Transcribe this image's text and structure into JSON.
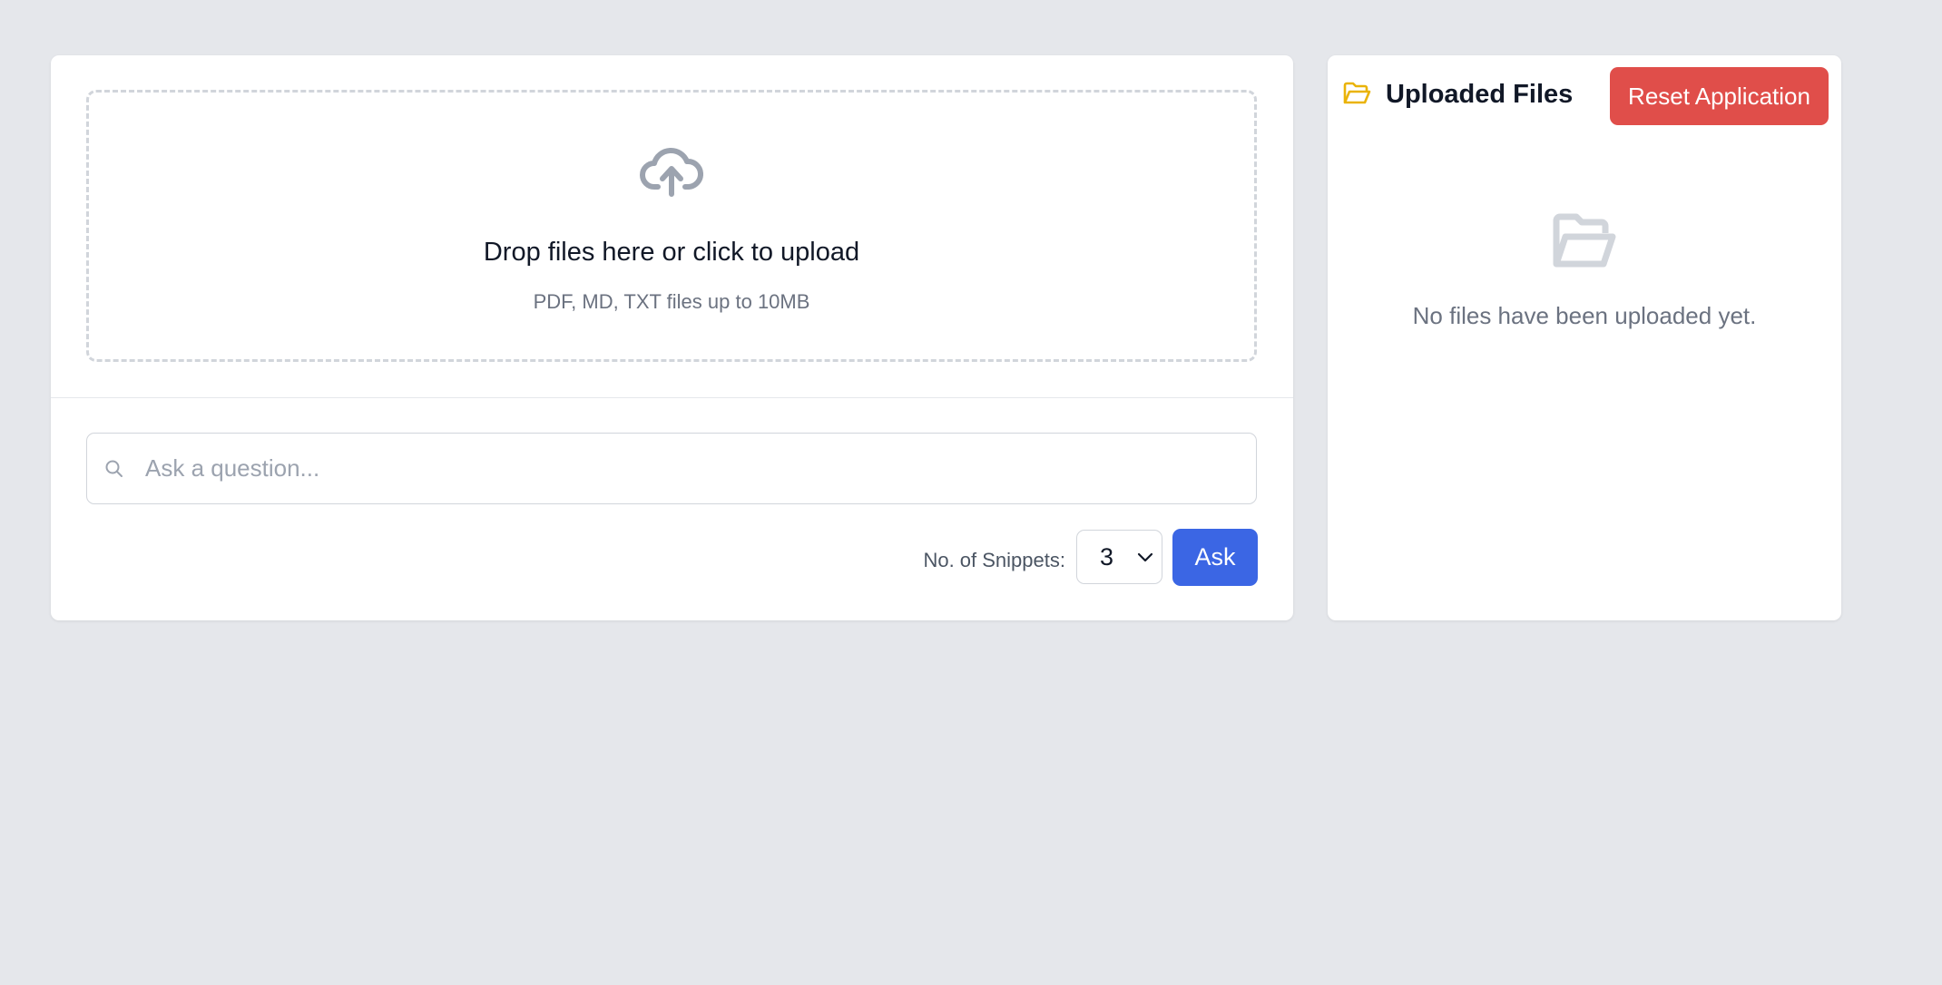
{
  "upload": {
    "icon": "cloud-upload-icon",
    "title": "Drop files here or click to upload",
    "subtitle": "PDF, MD, TXT files up to 10MB"
  },
  "query": {
    "search_icon": "search-icon",
    "placeholder": "Ask a question...",
    "value": "",
    "snippets_label": "No. of Snippets:",
    "snippets_value": "3",
    "ask_label": "Ask"
  },
  "files": {
    "icon": "folder-open-icon",
    "title": "Uploaded Files",
    "reset_label": "Reset Application",
    "empty_icon": "folder-open-icon",
    "empty_text": "No files have been uploaded yet."
  },
  "colors": {
    "background": "#e5e7eb",
    "primary": "#3b66e4",
    "danger": "#e04e4a",
    "folder_accent": "#eab308"
  }
}
